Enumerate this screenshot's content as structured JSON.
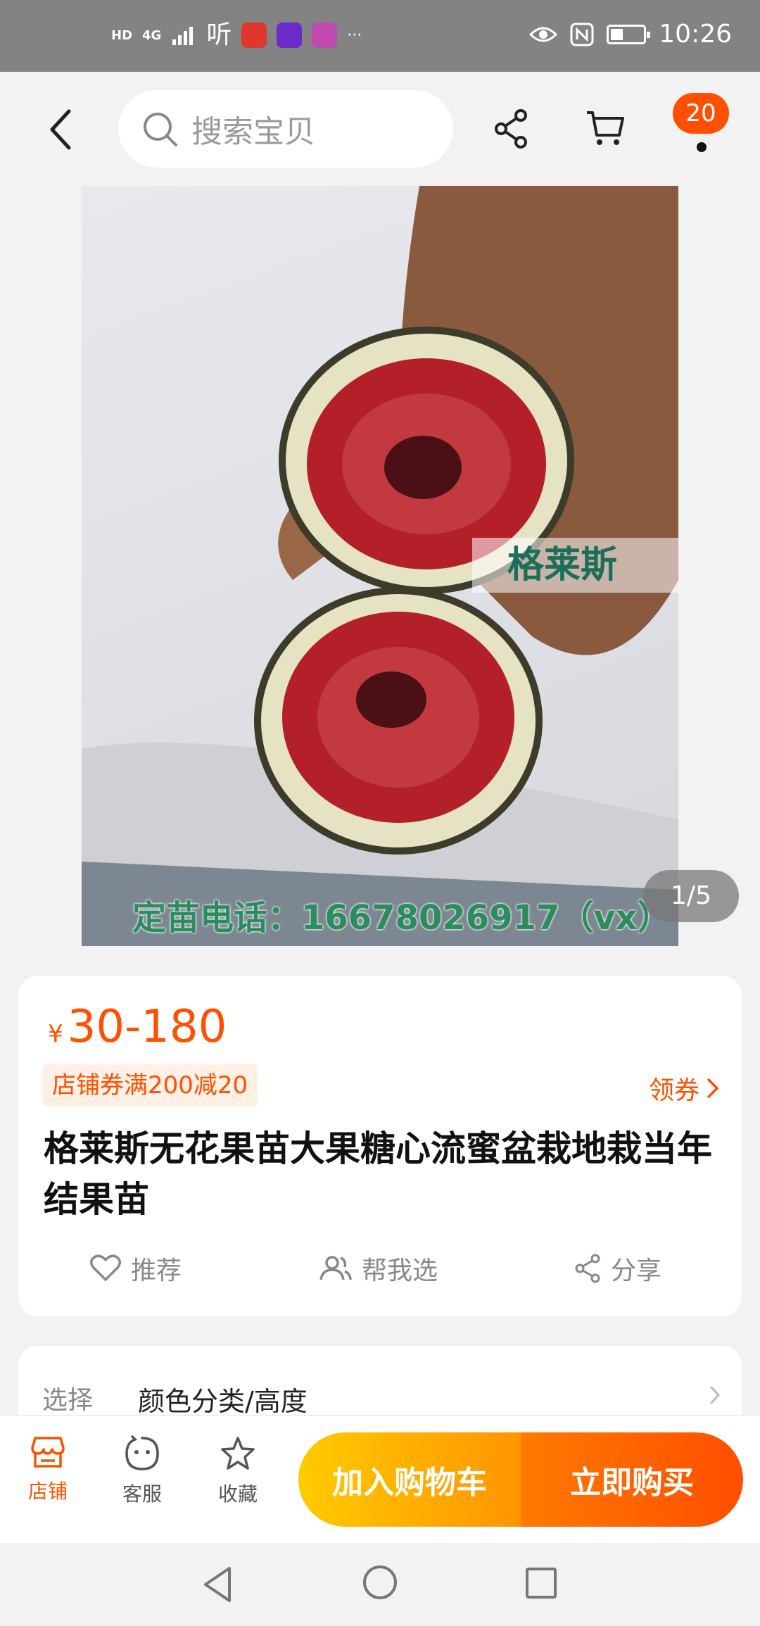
{
  "status_bar": {
    "time": "10:26",
    "hd_label": "HD",
    "network_label": "4G",
    "ting_app": "听",
    "more": "···"
  },
  "header": {
    "search_placeholder": "搜索宝贝",
    "message_badge": "20"
  },
  "gallery": {
    "counter": "1/5",
    "variety_label": "格莱斯",
    "phone_caption": "定苗电话：16678026917（vx）"
  },
  "product": {
    "currency": "¥",
    "price": "30-180",
    "coupon": "店铺券满200减20",
    "claim_coupon": "领券",
    "title": "格莱斯无花果苗大果糖心流蜜盆栽地栽当年结果苗"
  },
  "actions": {
    "recommend": "推荐",
    "help_pick": "帮我选",
    "share": "分享"
  },
  "options": {
    "label": "选择",
    "value": "颜色分类/高度"
  },
  "bottom_bar": {
    "store": "店铺",
    "service": "客服",
    "favorite": "收藏",
    "add_to_cart": "加入购物车",
    "buy_now": "立即购买"
  },
  "colors": {
    "accent": "#ff5000",
    "cart_button": "#ffa300",
    "buy_button": "#ff5000"
  }
}
